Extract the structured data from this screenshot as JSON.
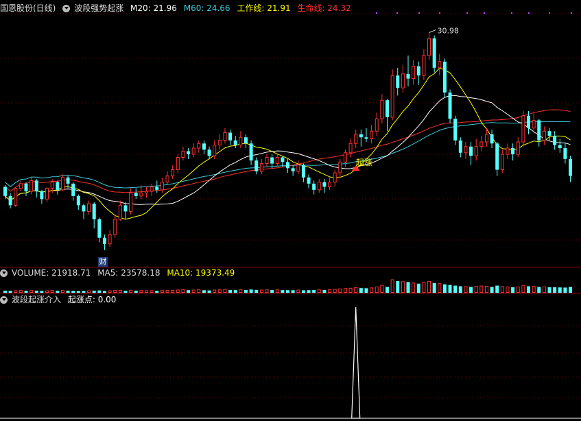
{
  "header": {
    "stock": "国恩股份(日线)",
    "indicator": "波段强势起涨",
    "m20": "M20: 21.96",
    "m60": "M60: 24.66",
    "work_line": "工作线: 21.91",
    "life_line": "生命线: 24.32",
    "colors": {
      "m20": "#ffffff",
      "m60": "#3fc9d8",
      "work": "#ffff00",
      "life": "#ff3030"
    }
  },
  "volume_header": {
    "volume": "VOLUME: 21918.71",
    "ma5": "MA5: 23578.18",
    "ma10": "MA10: 19373.49"
  },
  "indicator_header": {
    "name": "波段起涨介入",
    "value": "起涨点: 0.00"
  },
  "annotations": {
    "high_label": "30.98",
    "signal_label": "起涨",
    "finance_badge": "财"
  },
  "chart_data": {
    "type": "candlestick",
    "price_range": [
      16.0,
      32.2
    ],
    "high": 30.98,
    "candles": [
      [
        21.0,
        20.4,
        21.1,
        20.2
      ],
      [
        20.4,
        19.8,
        20.6,
        19.6
      ],
      [
        19.8,
        20.9,
        21.0,
        19.7
      ],
      [
        20.9,
        21.2,
        21.4,
        20.7
      ],
      [
        21.2,
        20.7,
        21.3,
        20.4
      ],
      [
        20.7,
        21.4,
        21.6,
        20.5
      ],
      [
        21.4,
        20.7,
        21.5,
        20.3
      ],
      [
        20.7,
        20.2,
        20.8,
        19.9
      ],
      [
        20.2,
        20.9,
        21.0,
        20.0
      ],
      [
        20.9,
        21.3,
        21.5,
        20.6
      ],
      [
        21.3,
        20.8,
        21.4,
        20.5
      ],
      [
        20.8,
        21.6,
        21.8,
        20.7
      ],
      [
        21.6,
        21.2,
        21.7,
        20.9
      ],
      [
        21.2,
        20.4,
        21.3,
        20.1
      ],
      [
        20.4,
        19.8,
        20.5,
        19.5
      ],
      [
        19.8,
        19.4,
        19.9,
        18.9
      ],
      [
        19.4,
        19.9,
        20.1,
        19.2
      ],
      [
        19.9,
        18.9,
        20.0,
        18.3
      ],
      [
        18.9,
        17.7,
        19.0,
        17.4
      ],
      [
        17.7,
        17.3,
        17.9,
        16.9
      ],
      [
        17.3,
        17.9,
        18.2,
        17.1
      ],
      [
        17.9,
        18.9,
        19.2,
        17.7
      ],
      [
        18.9,
        19.8,
        20.1,
        18.8
      ],
      [
        19.8,
        19.4,
        20.0,
        18.9
      ],
      [
        19.4,
        20.6,
        20.9,
        19.2
      ],
      [
        20.6,
        20.4,
        20.9,
        20.2
      ],
      [
        20.4,
        20.6,
        21.1,
        20.2
      ],
      [
        20.6,
        20.7,
        21.0,
        20.3
      ],
      [
        20.7,
        21.0,
        21.2,
        20.4
      ],
      [
        21.0,
        20.8,
        21.4,
        20.6
      ],
      [
        20.8,
        21.3,
        21.6,
        20.6
      ],
      [
        21.3,
        21.7,
        22.0,
        21.1
      ],
      [
        21.7,
        22.1,
        22.4,
        21.5
      ],
      [
        22.1,
        22.9,
        23.1,
        21.9
      ],
      [
        22.9,
        23.3,
        23.6,
        22.7
      ],
      [
        23.3,
        23.1,
        23.5,
        22.8
      ],
      [
        23.1,
        23.5,
        23.8,
        22.9
      ],
      [
        23.5,
        23.8,
        24.0,
        23.2
      ],
      [
        23.8,
        23.4,
        24.0,
        23.1
      ],
      [
        23.4,
        23.0,
        23.6,
        22.8
      ],
      [
        23.0,
        23.7,
        24.0,
        22.8
      ],
      [
        23.7,
        24.0,
        24.4,
        23.4
      ],
      [
        24.0,
        24.5,
        24.8,
        23.8
      ],
      [
        24.5,
        24.0,
        24.7,
        23.7
      ],
      [
        24.0,
        23.7,
        24.3,
        23.5
      ],
      [
        23.7,
        24.2,
        24.6,
        23.5
      ],
      [
        24.2,
        23.8,
        24.4,
        23.5
      ],
      [
        23.8,
        22.7,
        24.0,
        22.4
      ],
      [
        22.7,
        22.0,
        22.9,
        21.8
      ],
      [
        22.0,
        22.5,
        22.8,
        21.8
      ],
      [
        22.5,
        22.9,
        23.1,
        22.3
      ],
      [
        22.9,
        22.5,
        23.1,
        22.2
      ],
      [
        22.5,
        22.9,
        23.1,
        22.3
      ],
      [
        22.9,
        22.6,
        23.0,
        22.3
      ],
      [
        22.6,
        22.2,
        22.8,
        21.9
      ],
      [
        22.2,
        22.0,
        22.4,
        21.7
      ],
      [
        22.0,
        22.4,
        22.7,
        21.8
      ],
      [
        22.4,
        21.6,
        22.5,
        21.3
      ],
      [
        21.6,
        21.2,
        21.8,
        20.9
      ],
      [
        21.2,
        20.8,
        21.4,
        20.5
      ],
      [
        20.8,
        21.3,
        21.5,
        20.6
      ],
      [
        21.3,
        21.0,
        21.5,
        20.6
      ],
      [
        21.0,
        21.3,
        21.6,
        20.8
      ],
      [
        21.3,
        21.9,
        22.1,
        21.0
      ],
      [
        21.9,
        22.6,
        22.8,
        21.6
      ],
      [
        22.6,
        23.2,
        23.4,
        22.3
      ],
      [
        23.2,
        23.8,
        24.1,
        22.9
      ],
      [
        23.8,
        24.4,
        24.7,
        23.5
      ],
      [
        24.4,
        24.2,
        24.7,
        23.6
      ],
      [
        24.2,
        24.1,
        24.8,
        23.9
      ],
      [
        24.1,
        24.6,
        25.0,
        23.8
      ],
      [
        24.6,
        25.4,
        25.8,
        24.3
      ],
      [
        25.4,
        26.6,
        27.0,
        25.1
      ],
      [
        26.6,
        25.5,
        26.7,
        24.6
      ],
      [
        25.5,
        28.2,
        28.6,
        25.3
      ],
      [
        28.2,
        27.4,
        28.7,
        26.9
      ],
      [
        27.4,
        28.3,
        28.9,
        27.1
      ],
      [
        28.3,
        28.0,
        29.5,
        27.5
      ],
      [
        28.0,
        28.8,
        29.2,
        27.6
      ],
      [
        28.8,
        28.2,
        29.1,
        27.6
      ],
      [
        28.2,
        29.5,
        29.9,
        27.9
      ],
      [
        29.5,
        30.6,
        30.98,
        29.2
      ],
      [
        30.6,
        28.7,
        30.8,
        28.4
      ],
      [
        28.7,
        29.1,
        29.6,
        28.2
      ],
      [
        29.1,
        27.1,
        29.3,
        26.8
      ],
      [
        27.1,
        25.4,
        27.3,
        25.1
      ],
      [
        25.4,
        24.0,
        25.6,
        23.7
      ],
      [
        24.0,
        23.2,
        24.2,
        22.9
      ],
      [
        23.2,
        23.6,
        23.9,
        22.8
      ],
      [
        23.6,
        23.0,
        23.9,
        22.4
      ],
      [
        23.0,
        23.6,
        24.1,
        22.7
      ],
      [
        23.6,
        23.9,
        24.3,
        23.3
      ],
      [
        23.9,
        24.4,
        24.8,
        23.6
      ],
      [
        24.4,
        23.8,
        24.7,
        23.5
      ],
      [
        23.8,
        22.1,
        23.9,
        21.7
      ],
      [
        22.1,
        23.1,
        23.4,
        21.9
      ],
      [
        23.1,
        23.5,
        23.8,
        22.8
      ],
      [
        23.5,
        23.1,
        23.8,
        22.7
      ],
      [
        23.1,
        23.9,
        24.2,
        22.9
      ],
      [
        23.9,
        25.6,
        25.9,
        23.6
      ],
      [
        25.6,
        24.8,
        25.9,
        24.4
      ],
      [
        24.8,
        25.3,
        25.8,
        24.5
      ],
      [
        25.3,
        24.0,
        25.4,
        23.6
      ],
      [
        24.0,
        24.6,
        24.9,
        23.7
      ],
      [
        24.6,
        24.3,
        24.8,
        24.0
      ],
      [
        24.3,
        23.7,
        24.6,
        23.4
      ],
      [
        23.7,
        23.5,
        24.1,
        23.2
      ],
      [
        23.5,
        22.8,
        23.8,
        22.5
      ],
      [
        22.8,
        21.7,
        23.0,
        21.3
      ]
    ],
    "volumes": [
      330,
      300,
      310,
      360,
      320,
      340,
      330,
      300,
      310,
      350,
      320,
      380,
      330,
      300,
      280,
      290,
      310,
      330,
      360,
      300,
      310,
      350,
      370,
      320,
      360,
      330,
      340,
      320,
      330,
      320,
      340,
      360,
      380,
      430,
      480,
      400,
      420,
      450,
      390,
      360,
      420,
      450,
      520,
      430,
      410,
      460,
      420,
      500,
      440,
      420,
      450,
      420,
      440,
      410,
      400,
      390,
      420,
      380,
      400,
      420,
      450,
      430,
      460,
      520,
      600,
      650,
      700,
      800,
      720,
      700,
      750,
      900,
      1150,
      900,
      2000,
      1800,
      1700,
      1650,
      1500,
      1400,
      1600,
      1750,
      1500,
      1400,
      1300,
      1200,
      1100,
      1000,
      950,
      900,
      980,
      1050,
      1000,
      900,
      1100,
      950,
      900,
      850,
      900,
      1150,
      1000,
      980,
      900,
      900,
      860,
      850,
      820,
      800,
      900
    ],
    "indicator_spike_index": 67
  }
}
